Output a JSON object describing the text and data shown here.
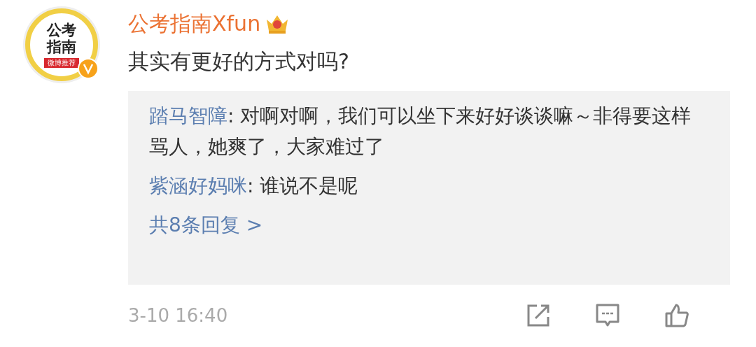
{
  "avatar": {
    "text": "公考指南",
    "ribbon": "微博推荐",
    "verified": true
  },
  "author": {
    "name": "公考指南Xfun",
    "crown": true
  },
  "comment": "其实有更好的方式对吗?",
  "replies": [
    {
      "user": "踏马智障",
      "text": ": 对啊对啊，我们可以坐下来好好谈谈嘛～非得要这样骂人，她爽了，大家难过了"
    },
    {
      "user": "紫涵好妈咪",
      "text": ": 谁说不是呢"
    }
  ],
  "more_replies": "共8条回复 >",
  "time": "3-10 16:40"
}
